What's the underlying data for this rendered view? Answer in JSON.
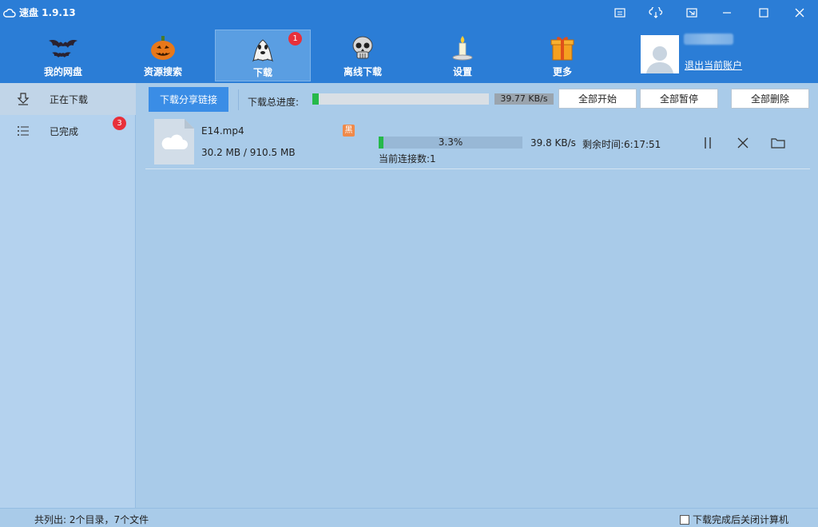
{
  "titlebar": {
    "title": "速盘 1.9.13",
    "icons": [
      "cloud-icon",
      "menu-icon",
      "skin-icon",
      "minimize-to-tray-icon",
      "minimize-icon",
      "maximize-icon",
      "close-icon"
    ]
  },
  "nav": {
    "items": [
      {
        "label": "我的网盘",
        "icon": "bat-icon"
      },
      {
        "label": "资源搜索",
        "icon": "pumpkin-icon"
      },
      {
        "label": "下载",
        "icon": "ghost-icon",
        "badge": "1"
      },
      {
        "label": "离线下载",
        "icon": "skull-icon"
      },
      {
        "label": "设置",
        "icon": "candle-icon"
      },
      {
        "label": "更多",
        "icon": "gift-box-icon"
      }
    ],
    "active": "下载",
    "logout": "退出当前账户"
  },
  "sidebar": {
    "items": [
      {
        "label": "正在下载",
        "icon": "download-arrow-icon"
      },
      {
        "label": "已完成",
        "icon": "list-icon",
        "badge": "3"
      }
    ]
  },
  "toolbar": {
    "share_link": "下载分享链接",
    "total_label": "下载总进度:",
    "total_progress": 0.035,
    "total_speed": "39.77 KB/s",
    "start_all": "全部开始",
    "pause_all": "全部暂停",
    "delete_all": "全部删除"
  },
  "download": {
    "file_name": "E14.mp4",
    "file_size": "30.2 MB / 910.5 MB",
    "badge": "黑",
    "percent_text": "3.3%",
    "progress": 0.033,
    "speed": "39.8 KB/s",
    "remaining": "剩余时间:6:17:51",
    "connections": "当前连接数:1"
  },
  "status": {
    "summary": "共列出: 2个目录，7个文件",
    "shutdown_label": "下载完成后关闭计算机"
  },
  "colors": {
    "primary": "#2b7dd6",
    "background": "#a9cbe9",
    "progress": "#26b94a",
    "badge": "#e8303a"
  }
}
